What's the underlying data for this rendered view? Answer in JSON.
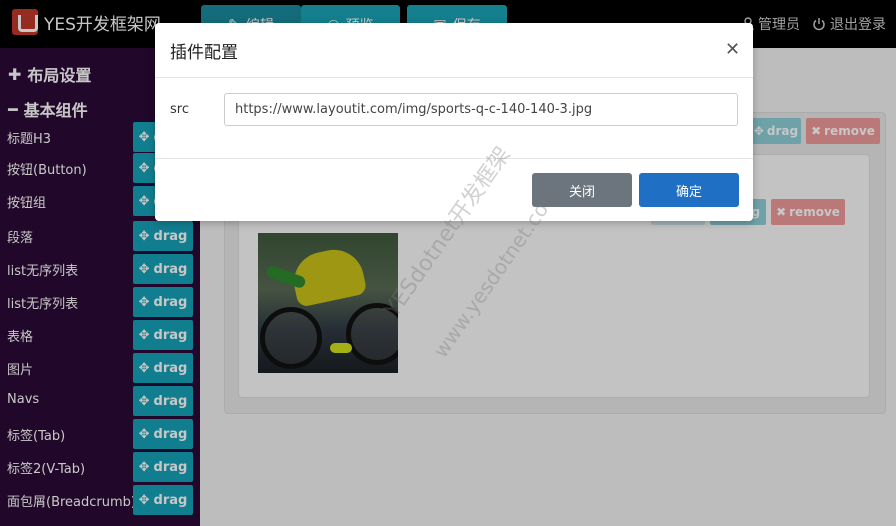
{
  "app": {
    "logo_text": "YES开发框架网"
  },
  "toolbar": {
    "edit_label": "编辑",
    "preview_label": "预览",
    "save_label": "保存"
  },
  "user": {
    "admin_label": "管理员",
    "logout_label": "退出登录"
  },
  "sidebar": {
    "layout_section": "布局设置",
    "base_section": "基本组件",
    "drag_label": "drag",
    "components": [
      "标题H3",
      "按钮(Button)",
      "按钮组",
      "段落",
      "list无序列表",
      "list无序列表",
      "表格",
      "图片",
      "Navs",
      "标签(Tab)",
      "标签2(V-Tab)",
      "面包屑(Breadcrumb)"
    ]
  },
  "canvas": {
    "ghost_drag": "drag",
    "ghost_remove": "remove"
  },
  "modal": {
    "title": "插件配置",
    "field_label": "src",
    "field_value": "https://www.layoutit.com/img/sports-q-c-140-140-3.jpg",
    "close_label": "关闭",
    "ok_label": "确定"
  },
  "watermark": {
    "line1": "YESdotnet开发框架",
    "line2": "www.yesdotnet.com"
  },
  "colors": {
    "accent": "#17a2b8",
    "sidebar": "#2b0a36",
    "primary": "#1f6fc5",
    "danger": "#f09a9a"
  }
}
